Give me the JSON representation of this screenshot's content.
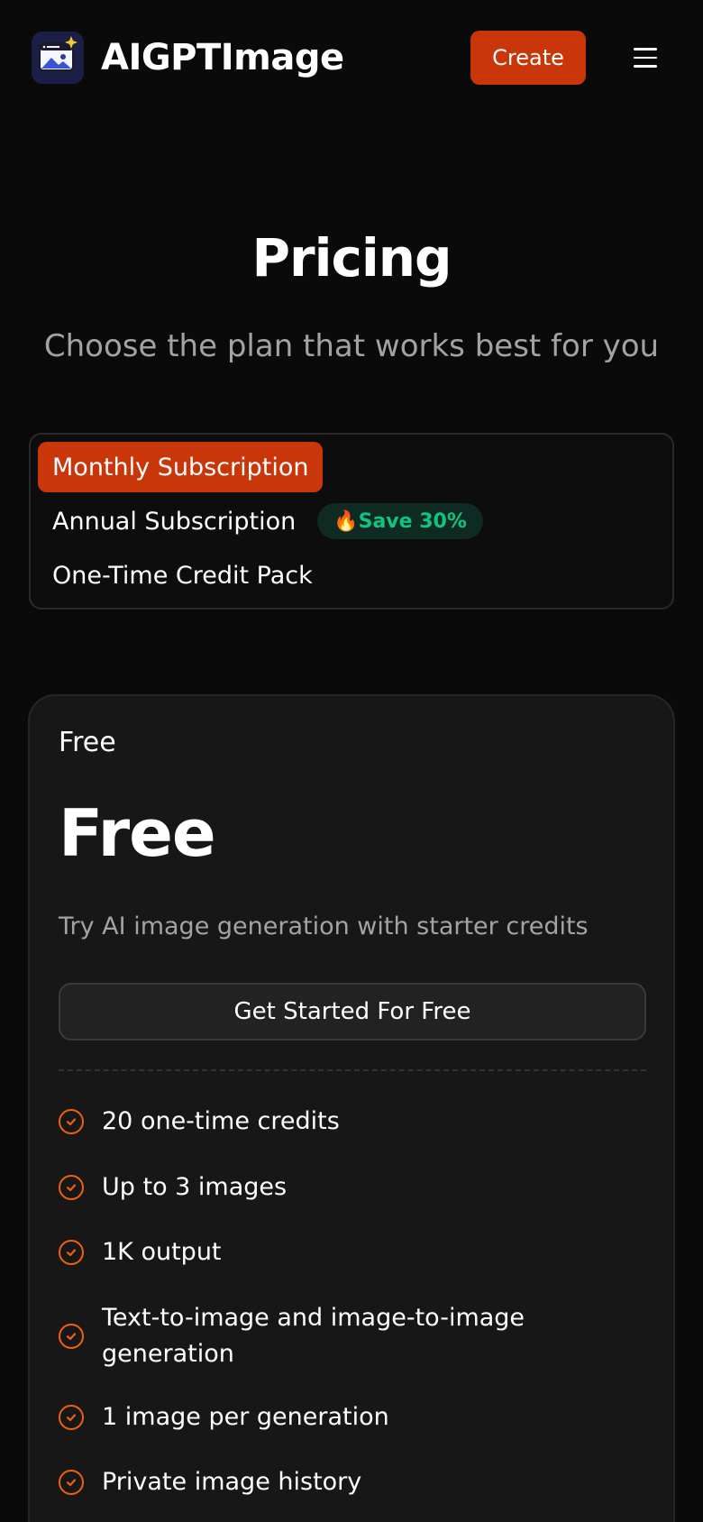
{
  "header": {
    "brand": "AIGPTImage",
    "create_label": "Create"
  },
  "hero": {
    "title": "Pricing",
    "subtitle": "Choose the plan that works best for you"
  },
  "tabs": [
    {
      "label": "Monthly Subscription",
      "active": true
    },
    {
      "label": "Annual Subscription",
      "active": false,
      "badge": "🔥Save 30%"
    },
    {
      "label": "One-Time Credit Pack",
      "active": false
    }
  ],
  "plan": {
    "name": "Free",
    "price": "Free",
    "description": "Try AI image generation with starter credits",
    "cta_label": "Get Started For Free",
    "features": [
      "20 one-time credits",
      "Up to 3 images",
      "1K output",
      "Text-to-image and image-to-image generation",
      "1 image per generation",
      "Private image history"
    ]
  },
  "colors": {
    "accent": "#c9360a",
    "check": "#f0620a",
    "save_badge_text": "#10c47f",
    "background": "#0a0a0a",
    "card": "#171717"
  },
  "icons": {
    "logo": "image-sparkle-icon",
    "menu": "hamburger-menu-icon",
    "feature": "check-circle-icon"
  }
}
